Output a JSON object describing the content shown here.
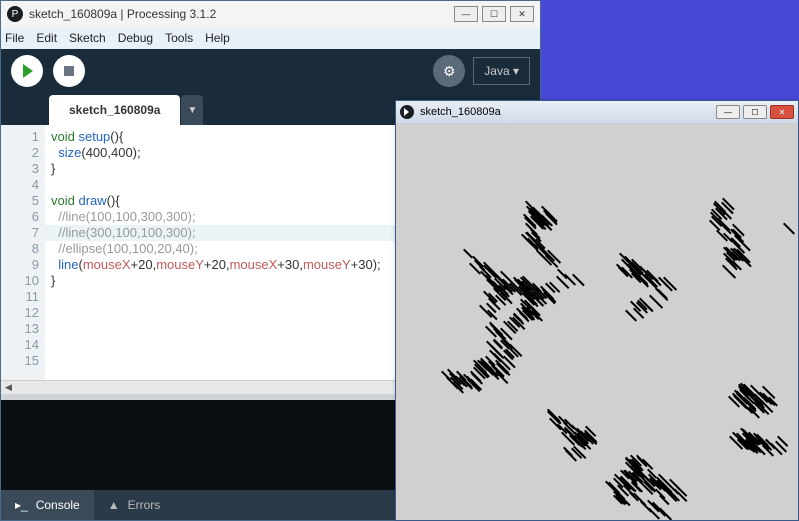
{
  "ide": {
    "title": "sketch_160809a | Processing 3.1.2",
    "menu": [
      "File",
      "Edit",
      "Sketch",
      "Debug",
      "Tools",
      "Help"
    ],
    "mode_label": "Java ▾",
    "tab_name": "sketch_160809a",
    "code_lines": [
      {
        "n": 1,
        "tokens": [
          [
            "kw",
            "void"
          ],
          [
            "",
            " "
          ],
          [
            "fn",
            "setup"
          ],
          [
            "",
            "(){"
          ]
        ]
      },
      {
        "n": 2,
        "tokens": [
          [
            "",
            "  "
          ],
          [
            "fn",
            "size"
          ],
          [
            "",
            "(400,400);"
          ]
        ]
      },
      {
        "n": 3,
        "tokens": [
          [
            "",
            "}"
          ]
        ]
      },
      {
        "n": 4,
        "tokens": [
          [
            "",
            ""
          ]
        ]
      },
      {
        "n": 5,
        "tokens": [
          [
            "kw",
            "void"
          ],
          [
            "",
            " "
          ],
          [
            "fn",
            "draw"
          ],
          [
            "",
            "(){"
          ]
        ]
      },
      {
        "n": 6,
        "tokens": [
          [
            "",
            "  "
          ],
          [
            "cm",
            "//line(100,100,300,300);"
          ]
        ]
      },
      {
        "n": 7,
        "tokens": [
          [
            "",
            "  "
          ],
          [
            "cm",
            "//line(300,100,100,300);"
          ]
        ],
        "hl": true
      },
      {
        "n": 8,
        "tokens": [
          [
            "",
            "  "
          ],
          [
            "cm",
            "//ellipse(100,100,20,40);"
          ]
        ]
      },
      {
        "n": 9,
        "tokens": [
          [
            "",
            "  "
          ],
          [
            "fn",
            "line"
          ],
          [
            "",
            "("
          ],
          [
            "var",
            "mouseX"
          ],
          [
            "",
            "+20,"
          ],
          [
            "var",
            "mouseY"
          ],
          [
            "",
            "+20,"
          ],
          [
            "var",
            "mouseX"
          ],
          [
            "",
            "+30,"
          ],
          [
            "var",
            "mouseY"
          ],
          [
            "",
            "+30);"
          ]
        ]
      },
      {
        "n": 10,
        "tokens": [
          [
            "",
            "}"
          ]
        ]
      },
      {
        "n": 11,
        "tokens": [
          [
            "",
            ""
          ]
        ]
      },
      {
        "n": 12,
        "tokens": [
          [
            "",
            ""
          ]
        ]
      },
      {
        "n": 13,
        "tokens": [
          [
            "",
            ""
          ]
        ]
      },
      {
        "n": 14,
        "tokens": [
          [
            "",
            ""
          ]
        ]
      },
      {
        "n": 15,
        "tokens": [
          [
            "",
            ""
          ]
        ]
      }
    ],
    "footer_tabs": {
      "console": "Console",
      "errors": "Errors"
    }
  },
  "sketch": {
    "title": "sketch_160809a"
  }
}
